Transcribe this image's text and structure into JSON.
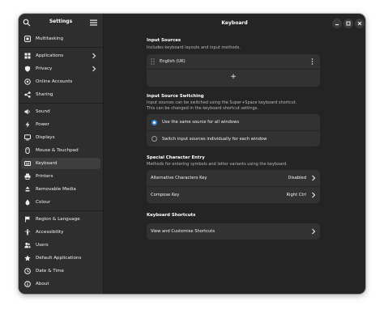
{
  "sidebar": {
    "title": "Settings",
    "groups": [
      [
        {
          "label": "Multitasking",
          "icon": "multitasking-icon"
        }
      ],
      [
        {
          "label": "Applications",
          "icon": "applications-icon",
          "chevron": true
        },
        {
          "label": "Privacy",
          "icon": "privacy-icon",
          "chevron": true
        },
        {
          "label": "Online Accounts",
          "icon": "online-accounts-icon"
        },
        {
          "label": "Sharing",
          "icon": "sharing-icon"
        }
      ],
      [
        {
          "label": "Sound",
          "icon": "sound-icon"
        },
        {
          "label": "Power",
          "icon": "power-icon"
        },
        {
          "label": "Displays",
          "icon": "displays-icon"
        },
        {
          "label": "Mouse & Touchpad",
          "icon": "mouse-icon"
        },
        {
          "label": "Keyboard",
          "icon": "keyboard-icon",
          "active": true
        },
        {
          "label": "Printers",
          "icon": "printers-icon"
        },
        {
          "label": "Removable Media",
          "icon": "removable-media-icon"
        },
        {
          "label": "Colour",
          "icon": "colour-icon"
        }
      ],
      [
        {
          "label": "Region & Language",
          "icon": "region-icon"
        },
        {
          "label": "Accessibility",
          "icon": "accessibility-icon"
        },
        {
          "label": "Users",
          "icon": "users-icon"
        },
        {
          "label": "Default Applications",
          "icon": "default-apps-icon"
        },
        {
          "label": "Date & Time",
          "icon": "date-time-icon"
        },
        {
          "label": "About",
          "icon": "about-icon"
        }
      ]
    ]
  },
  "main": {
    "title": "Keyboard",
    "input_sources": {
      "title": "Input Sources",
      "desc": "Includes keyboard layouts and input methods.",
      "items": [
        "English (UK)"
      ],
      "add_label": "+"
    },
    "switching": {
      "title": "Input Source Switching",
      "desc1": "Input sources can be switched using the Super+Space keyboard shortcut.",
      "desc2": "This can be changed in the keyboard shortcut settings.",
      "option_same": "Use the same source for all windows",
      "option_individual": "Switch input sources individually for each window",
      "selected": "same"
    },
    "special": {
      "title": "Special Character Entry",
      "desc": "Methods for entering symbols and letter variants using the keyboard.",
      "alt_label": "Alternative Characters Key",
      "alt_value": "Disabled",
      "compose_label": "Compose Key",
      "compose_value": "Right Ctrl"
    },
    "shortcuts": {
      "title": "Keyboard Shortcuts",
      "view_label": "View and Customise Shortcuts"
    }
  },
  "colors": {
    "accent": "#3584e4",
    "window_bg": "#242424",
    "sidebar_bg": "#2e2e2e",
    "card_bg": "#323232"
  }
}
